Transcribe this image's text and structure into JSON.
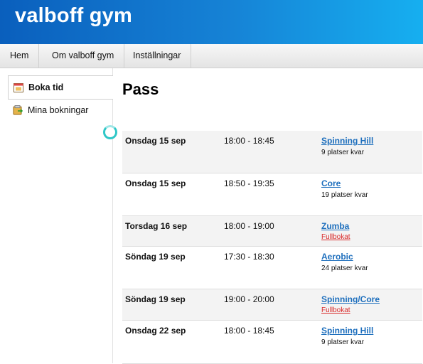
{
  "header": {
    "title": "valboff gym"
  },
  "nav": {
    "items": [
      "Hem",
      "Om valboff gym",
      "Inställningar"
    ]
  },
  "sidebar": {
    "items": [
      {
        "label": "Boka tid",
        "icon": "calendar-icon",
        "active": true
      },
      {
        "label": "Mina bokningar",
        "icon": "bookings-icon",
        "active": false
      }
    ]
  },
  "main": {
    "title": "Pass",
    "rows": [
      {
        "day": "Onsdag 15 sep",
        "time": "18:00 - 18:45",
        "class": "Spinning Hill",
        "status": "9 platser kvar",
        "full": false
      },
      {
        "day": "Onsdag 15 sep",
        "time": "18:50 - 19:35",
        "class": "Core",
        "status": "19 platser kvar",
        "full": false
      },
      {
        "day": "Torsdag 16 sep",
        "time": "18:00 - 19:00",
        "class": "Zumba",
        "status": "Fullbokat",
        "full": true
      },
      {
        "day": "Söndag 19 sep",
        "time": "17:30 - 18:30",
        "class": "Aerobic",
        "status": "24 platser kvar",
        "full": false
      },
      {
        "day": "Söndag 19 sep",
        "time": "19:00 - 20:00",
        "class": "Spinning/Core",
        "status": "Fullbokat",
        "full": true
      },
      {
        "day": "Onsdag 22 sep",
        "time": "18:00 - 18:45",
        "class": "Spinning Hill",
        "status": "9 platser kvar",
        "full": false
      }
    ]
  },
  "colors": {
    "link": "#1e6fbd",
    "full": "#d92b2b",
    "header_start": "#0a5fbd",
    "header_end": "#16aff0"
  }
}
